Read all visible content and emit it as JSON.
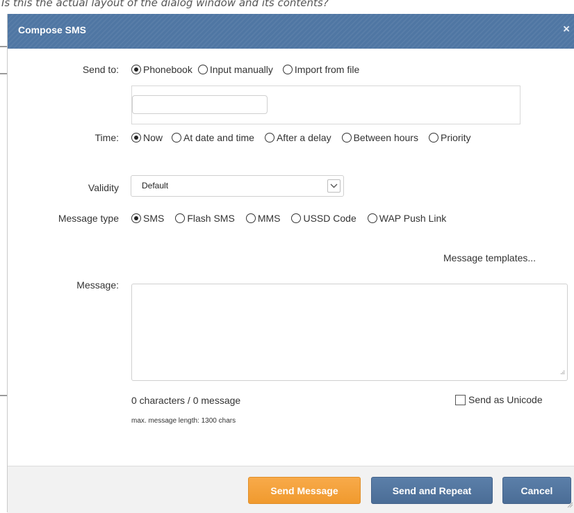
{
  "background": {
    "overlay_text": "Compose SMS dialog over background page"
  },
  "dialog": {
    "title": "Compose SMS",
    "close_glyph": "×",
    "colors": {
      "titlebar": "#4f76a3",
      "primary_button": "#f09a2e",
      "secondary_button": "#4b6d96"
    }
  },
  "send_to": {
    "label": "Send to:",
    "options": [
      "Phonebook",
      "Input manually",
      "Import from file"
    ],
    "selected": "Phonebook"
  },
  "time": {
    "label": "Time:",
    "options": [
      "Now",
      "At date and time",
      "After a delay",
      "Between hours",
      "Priority"
    ],
    "selected": "Now"
  },
  "validity": {
    "label": "Validity",
    "value": "Default",
    "arrow_icon": "chevron-down-icon"
  },
  "message_type": {
    "label": "Message type",
    "options": [
      "SMS",
      "Flash SMS",
      "MMS",
      "USSD Code",
      "WAP Push Link"
    ],
    "selected": "SMS"
  },
  "templates_link": "Message templates...",
  "message": {
    "label": "Message:",
    "value": "",
    "counter": "0 characters / 0 message",
    "max_length_note": "max. message length: 1300 chars"
  },
  "unicode": {
    "label": "Send as Unicode",
    "checked": false
  },
  "footer": {
    "send_label": "Send Message",
    "repeat_label": "Send and Repeat",
    "cancel_label": "Cancel"
  }
}
